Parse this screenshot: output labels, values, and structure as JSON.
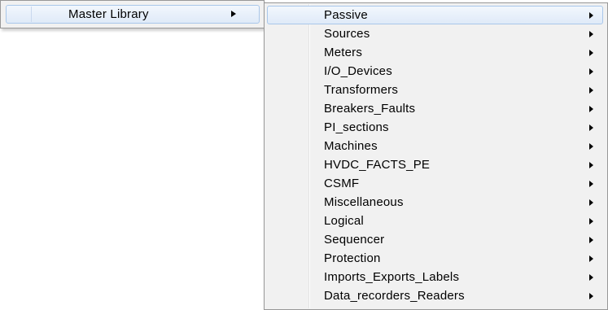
{
  "parent_menu": {
    "label": "Master Library",
    "submenu_indicator": "chevron-right-icon"
  },
  "submenu": {
    "highlighted_index": 0,
    "items": [
      {
        "label": "Passive"
      },
      {
        "label": "Sources"
      },
      {
        "label": "Meters"
      },
      {
        "label": "I/O_Devices"
      },
      {
        "label": "Transformers"
      },
      {
        "label": "Breakers_Faults"
      },
      {
        "label": "PI_sections"
      },
      {
        "label": "Machines"
      },
      {
        "label": "HVDC_FACTS_PE"
      },
      {
        "label": "CSMF"
      },
      {
        "label": "Miscellaneous"
      },
      {
        "label": "Logical"
      },
      {
        "label": "Sequencer"
      },
      {
        "label": "Protection"
      },
      {
        "label": "Imports_Exports_Labels"
      },
      {
        "label": "Data_recorders_Readers"
      }
    ]
  },
  "colors": {
    "menu_background": "#f1f1f1",
    "menu_border": "#979797",
    "highlight_border": "#a9c7ea",
    "highlight_fill_top": "#f2f7fd",
    "highlight_fill_bottom": "#dfeaf8"
  }
}
